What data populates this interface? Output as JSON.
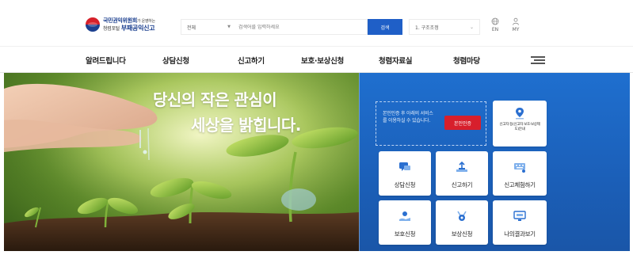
{
  "header": {
    "logo_line1": "국민권익위원회",
    "logo_line1_tail": "가 운영하는",
    "logo_small": "청렴포털",
    "logo_line2": "부패공익신고",
    "search_category": "전체",
    "search_placeholder": "검색어를 입력하세요",
    "search_button": "검색",
    "select_value": "1. 구조조정",
    "util_en": "EN",
    "util_my": "MY"
  },
  "nav": {
    "items": [
      "알려드립니다",
      "상담신청",
      "신고하기",
      "보호·보상신청",
      "청렴자료실",
      "청렴마당"
    ]
  },
  "hero": {
    "slogan_line1": "당신의 작은 관심이",
    "slogan_line2": "세상을 밝힙니다."
  },
  "services": {
    "auth_text": "본인인증 후 아래의 서비스를 이용하실 수 있습니다.",
    "auth_button": "본인인증",
    "guide_label": "신고자 등(신고자 보호·보상제도)안내",
    "cards": [
      "상담신청",
      "신고하기",
      "신고체험하기",
      "보호신청",
      "보상신청",
      "나의결과보기"
    ]
  },
  "colors": {
    "brand_blue": "#1f5fc7",
    "panel_blue": "#1b5fb8",
    "auth_red": "#d71f2c"
  }
}
